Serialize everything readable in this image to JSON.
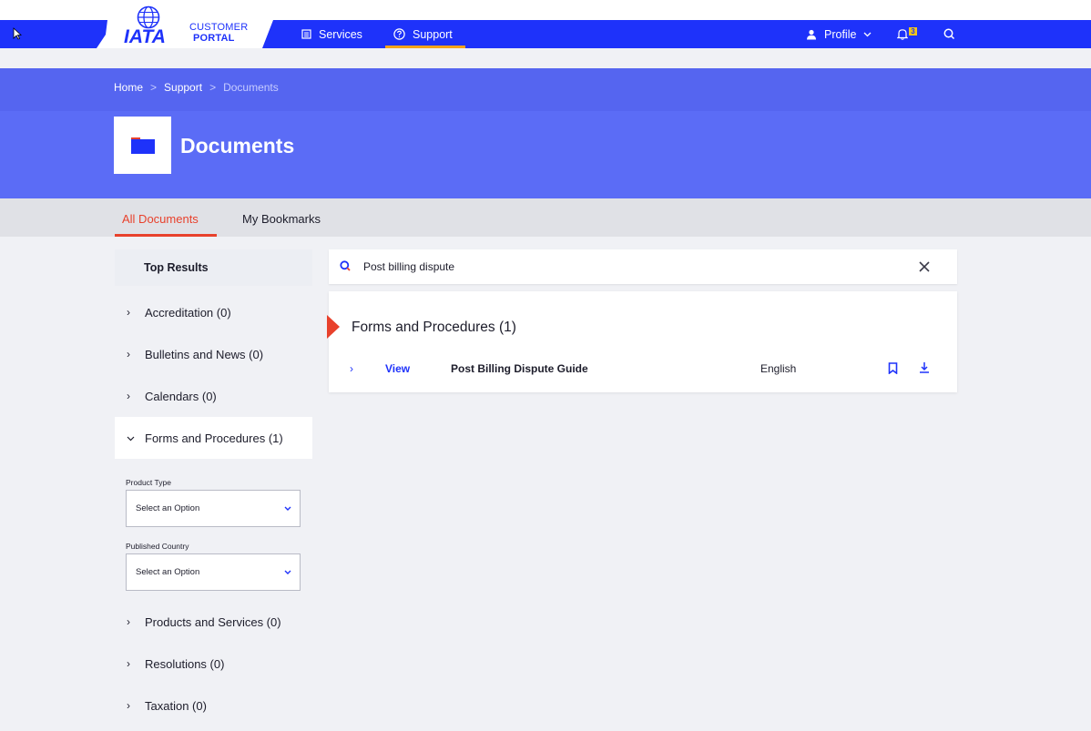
{
  "nav": {
    "logo_word": "IATA",
    "logo_line1": "CUSTOMER",
    "logo_line2": "PORTAL",
    "services_label": "Services",
    "support_label": "Support",
    "profile_label": "Profile",
    "notification_count": "3",
    "accent_color": "#1e32fa",
    "support_underline_color": "#f2a31b"
  },
  "breadcrumb": {
    "home": "Home",
    "support": "Support",
    "current": "Documents",
    "separator": ">"
  },
  "header": {
    "title": "Documents",
    "icon": "folder-icon"
  },
  "tabs": {
    "all_documents": "All Documents",
    "my_bookmarks": "My Bookmarks",
    "active_color": "#e8412c"
  },
  "sidebar": {
    "top_results": "Top Results",
    "categories": [
      {
        "label": "Accreditation (0)",
        "expanded": false
      },
      {
        "label": "Bulletins and News (0)",
        "expanded": false
      },
      {
        "label": "Calendars (0)",
        "expanded": false
      },
      {
        "label": "Forms and Procedures (1)",
        "expanded": true
      },
      {
        "label": "Products and Services (0)",
        "expanded": false
      },
      {
        "label": "Resolutions (0)",
        "expanded": false
      },
      {
        "label": "Taxation (0)",
        "expanded": false
      }
    ],
    "filters": {
      "product_type_label": "Product Type",
      "product_type_value": "Select an Option",
      "published_country_label": "Published Country",
      "published_country_value": "Select an Option"
    }
  },
  "search": {
    "query": "Post billing dispute"
  },
  "results": {
    "heading": "Forms and Procedures (1)",
    "rows": [
      {
        "action": "View",
        "title": "Post Billing Dispute Guide",
        "language": "English"
      }
    ]
  }
}
